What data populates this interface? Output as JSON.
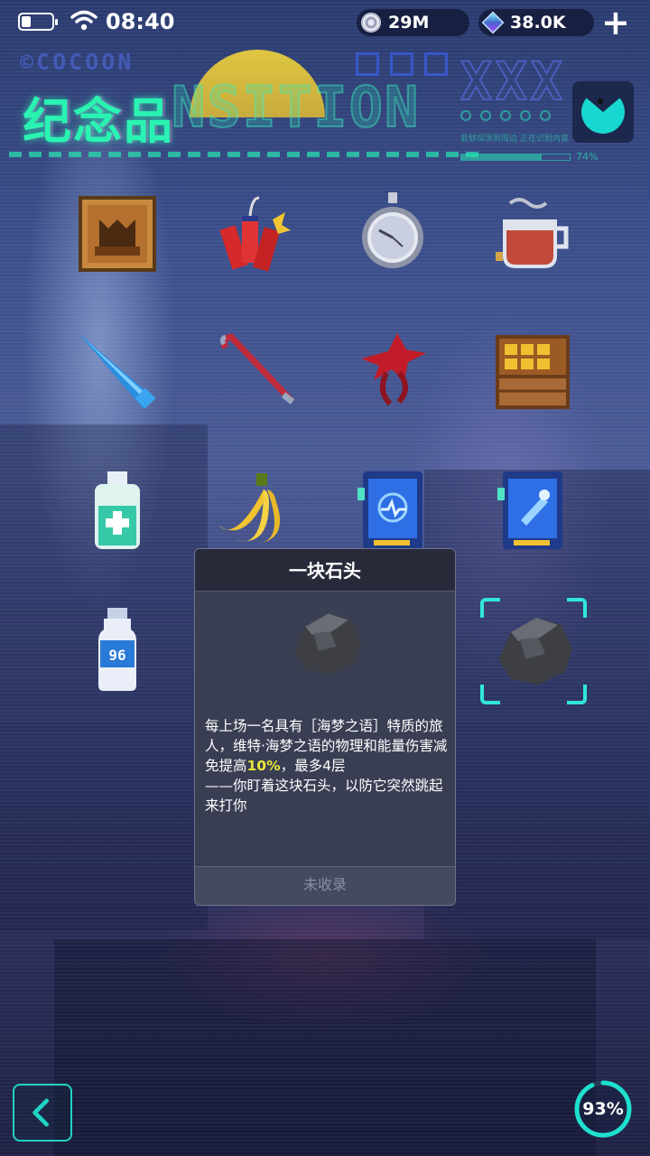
{
  "status_bar": {
    "time": "08:40",
    "coins": "29M",
    "gems": "38.0K",
    "plus_label": "+"
  },
  "header": {
    "title": "纪念品",
    "deco_brand": "©COCOON",
    "deco_word": "NSITION",
    "deco_small": "能够探测到周边   正在识别内容",
    "deco_progress": "74%"
  },
  "items": [
    {
      "name": "framed-painting",
      "icon": "painting-icon"
    },
    {
      "name": "firecrackers",
      "icon": "firecracker-icon"
    },
    {
      "name": "pocket-watch",
      "icon": "pocket-watch-icon"
    },
    {
      "name": "tea-cup",
      "icon": "tea-cup-icon"
    },
    {
      "name": "ice-horn",
      "icon": "ice-horn-icon"
    },
    {
      "name": "crowbar",
      "icon": "crowbar-icon"
    },
    {
      "name": "red-tentacle",
      "icon": "tentacle-icon"
    },
    {
      "name": "wooden-crate",
      "icon": "crate-icon"
    },
    {
      "name": "sanitizer",
      "icon": "sanitizer-icon"
    },
    {
      "name": "bananas",
      "icon": "banana-icon"
    },
    {
      "name": "blue-card-a",
      "icon": "blue-card-icon"
    },
    {
      "name": "blue-card-b",
      "icon": "blue-card-icon"
    },
    {
      "name": "water-bottle",
      "icon": "bottle-icon"
    },
    {
      "name": "rock",
      "icon": "rock-icon",
      "selected": true
    }
  ],
  "bottle_label": "96",
  "popup": {
    "title": "一块石头",
    "desc_line1": "每上场一名具有［海梦之语］特质的旅人，维特·海梦之语的物理和能量伤害减免提高",
    "desc_highlight": "10%",
    "desc_line1_end": "，最多4层",
    "desc_line2": "——你盯着这块石头，以防它突然跳起来打你",
    "footer": "未收录"
  },
  "bottom": {
    "back_icon": "chevron-left-icon",
    "progress_label": "93%",
    "progress_value": 0.93
  },
  "colors": {
    "accent": "#2af3b2",
    "frame": "#31e6d9",
    "highlight": "#e7e63b"
  }
}
